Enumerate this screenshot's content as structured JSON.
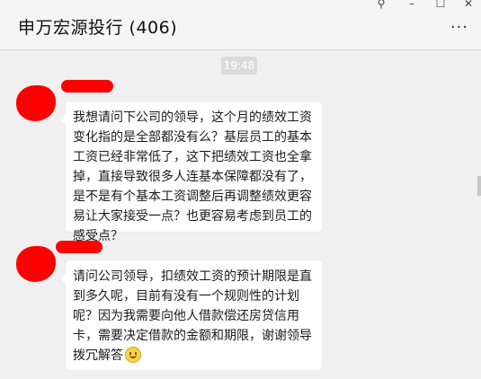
{
  "window": {
    "title": "申万宏源投行 (406)",
    "controls": [
      "⚲",
      "–",
      "☐",
      "✕"
    ],
    "more_label": "···"
  },
  "chat": {
    "timestamp": "19:48",
    "messages": [
      {
        "sender": "redacted",
        "text": "我想请问下公司的领导，这个月的绩效工资变化指的是全部都没有么？基层员工的基本工资已经非常低了，这下把绩效工资也全拿掉，直接导致很多人连基本保障都没有了，是不是有个基本工资调整后再调整绩效更容易让大家接受一点？也更容易考虑到员工的感受点？"
      },
      {
        "sender": "redacted",
        "text": "请问公司领导，扣绩效工资的预计期限是直到多久呢，目前有没有一个规则性的计划呢？因为我需要向他人借款偿还房贷信用卡，需要决定借款的金额和期限，谢谢领导拨冗解答",
        "emoji": "smile-emoji"
      }
    ]
  },
  "colors": {
    "redaction": "#ff0000",
    "background": "#f0f0f0",
    "bubble": "#ffffff"
  }
}
